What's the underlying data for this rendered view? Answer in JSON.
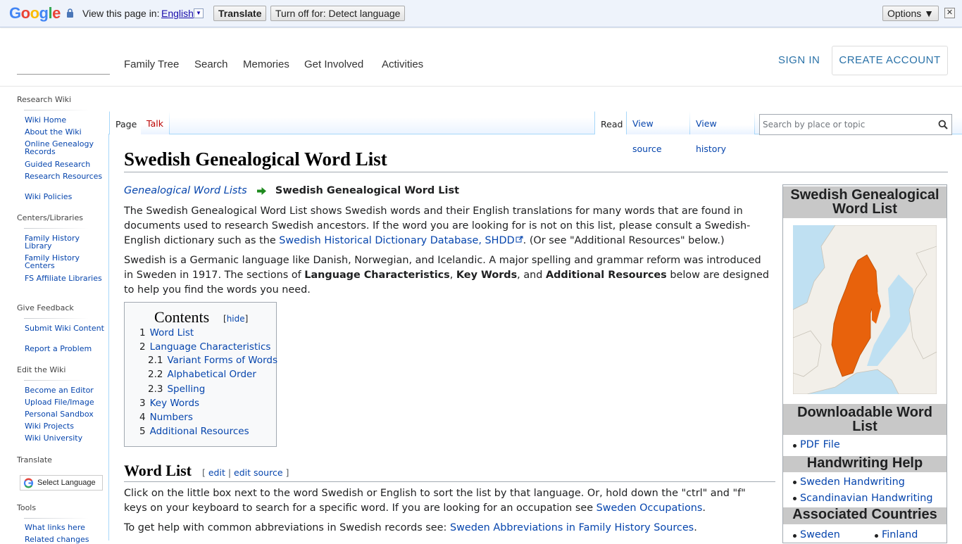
{
  "translate_bar": {
    "view_in": "View this page in:",
    "language": "English",
    "translate_button": "Translate",
    "turn_off_button": "Turn off for: Detect language",
    "options_button": "Options ▼",
    "close": "✕"
  },
  "header": {
    "nav": [
      "Family Tree",
      "Search",
      "Memories",
      "Get Involved",
      "Activities"
    ],
    "sign_in": "SIGN IN",
    "create_account": "CREATE ACCOUNT"
  },
  "sidebar": {
    "research_wiki": "Research Wiki",
    "research_links": [
      "Wiki Home",
      "About the Wiki",
      "Online Genealogy Records",
      "Guided Research",
      "Research Resources",
      "Wiki Policies"
    ],
    "centers": "Centers/Libraries",
    "centers_links": [
      "Family History Library",
      "Family History Centers",
      "FS Affiliate Libraries"
    ],
    "feedback": "Give Feedback",
    "feedback_links": [
      "Submit Wiki Content",
      "Report a Problem"
    ],
    "edit": "Edit the Wiki",
    "edit_links": [
      "Become an Editor",
      "Upload File/Image",
      "Personal Sandbox",
      "Wiki Projects",
      "Wiki University"
    ],
    "translate": "Translate",
    "select_language": "Select Language",
    "tools": "Tools",
    "tools_links": [
      "What links here",
      "Related changes"
    ]
  },
  "tabs": {
    "page": "Page",
    "talk": "Talk",
    "read": "Read",
    "view_source": "View source",
    "view_history": "View history",
    "search_placeholder": "Search by place or topic"
  },
  "article": {
    "title": "Swedish Genealogical Word List",
    "breadcrumb_link": "Genealogical Word Lists",
    "breadcrumb_current": "Swedish Genealogical Word List",
    "p1_a": "The Swedish Genealogical Word List shows Swedish words and their English translations for many words that are found in documents used to research Swedish ancestors. If the word you are looking for is not on this list, please consult a Swedish-English dictionary such as the ",
    "p1_link": "Swedish Historical Dictionary Database, SHDD",
    "p1_b": ". (Or see \"Additional Resources\" below.)",
    "p2_a": "Swedish is a Germanic language like Danish, Norwegian, and Icelandic. A major spelling and grammar reform was introduced in Sweden in 1917. The sections of ",
    "p2_bold1": "Language Characteristics",
    "p2_sep1": ", ",
    "p2_bold2": "Key Words",
    "p2_sep2": ", and ",
    "p2_bold3": "Additional Resources",
    "p2_b": " below are designed to help you find the words you need.",
    "toc_title": "Contents",
    "toc_hide": "hide",
    "toc": [
      {
        "num": "1",
        "label": "Word List"
      },
      {
        "num": "2",
        "label": "Language Characteristics"
      },
      {
        "num": "2.1",
        "label": "Variant Forms of Words"
      },
      {
        "num": "2.2",
        "label": "Alphabetical Order"
      },
      {
        "num": "2.3",
        "label": "Spelling"
      },
      {
        "num": "3",
        "label": "Key Words"
      },
      {
        "num": "4",
        "label": "Numbers"
      },
      {
        "num": "5",
        "label": "Additional Resources"
      }
    ],
    "wl_heading": "Word List",
    "wl_edit": "edit",
    "wl_edit_source": "edit source",
    "p3_a": "Click on the little box next to the word Swedish or English to sort the list by that language. Or, hold down the \"ctrl\" and \"f\" keys on your keyboard to search for a specific word. If you are looking for an occupation see ",
    "p3_link": "Sweden Occupations",
    "p3_b": ".",
    "p4_a": "To get help with common abbreviations in Swedish records see: ",
    "p4_link": "Sweden Abbreviations in Family History Sources",
    "p4_b": "."
  },
  "infobox": {
    "title": "Swedish Genealogical Word List",
    "downloadable": "Downloadable Word List",
    "pdf": "PDF File",
    "handwriting": "Handwriting Help",
    "hw_links": [
      "Sweden Handwriting",
      "Scandinavian Handwriting"
    ],
    "associated": "Associated Countries",
    "countries": [
      "Sweden",
      "Finland"
    ]
  },
  "colors": {
    "link": "#0645ad",
    "sweden_map": "#e8620c",
    "infobox_header": "#c8c8c8"
  }
}
